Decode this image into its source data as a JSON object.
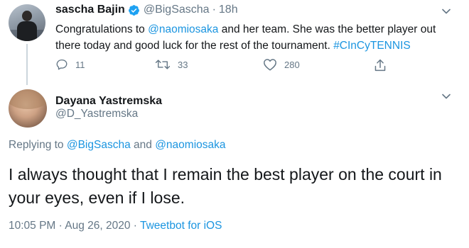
{
  "tweet1": {
    "display_name": "sascha Bajin",
    "handle": "@BigSascha",
    "separator": "·",
    "time": "18h",
    "text_part1": "Congratulations to ",
    "mention": "@naomiosaka",
    "text_part2": " and her team. She was the better player out there today and good luck for the rest of the tournament. ",
    "hashtag": "#CInCyTENNIS",
    "actions": {
      "reply_count": "11",
      "retweet_count": "33",
      "like_count": "280"
    }
  },
  "tweet2": {
    "display_name": "Dayana Yastremska",
    "handle": "@D_Yastremska",
    "replying_prefix": "Replying to ",
    "replying_user1": "@BigSascha",
    "replying_and": " and ",
    "replying_user2": "@naomiosaka",
    "text": "I always thought that I remain the best player on the court in your eyes, even if I lose.",
    "timestamp": "10:05 PM · Aug 26, 2020",
    "meta_separator": " · ",
    "source": "Tweetbot for iOS"
  },
  "colors": {
    "link": "#1b95e0",
    "muted": "#657786",
    "text": "#14171a",
    "verified": "#1da1f2"
  },
  "icons": [
    "verified-badge-icon",
    "chevron-down-icon",
    "reply-icon",
    "retweet-icon",
    "like-icon",
    "share-icon"
  ]
}
